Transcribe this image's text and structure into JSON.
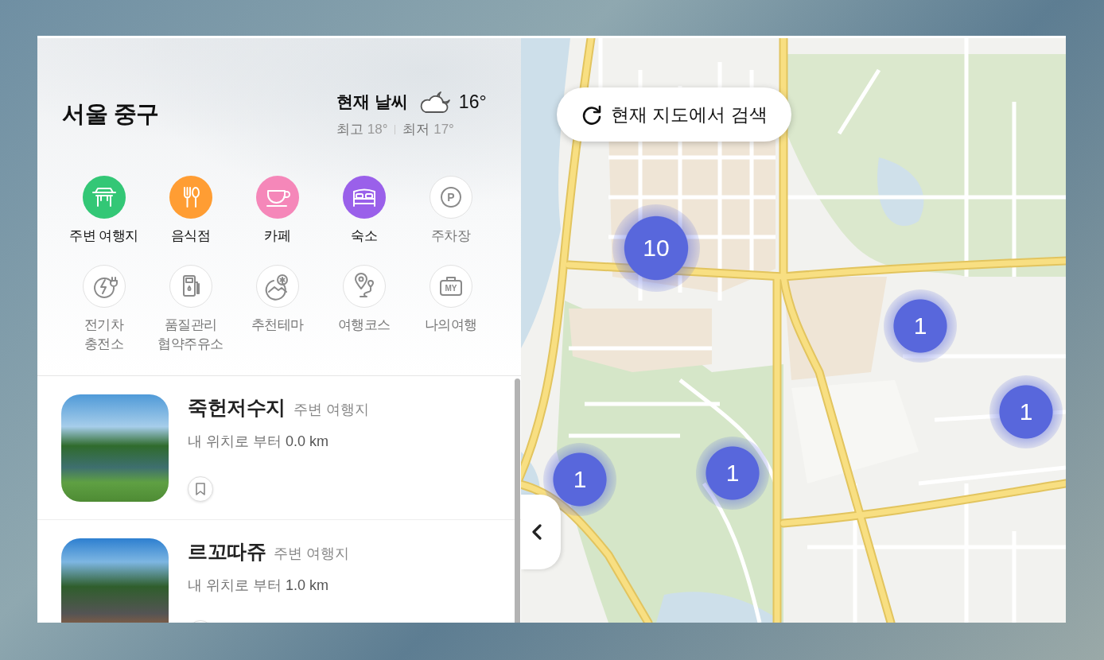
{
  "location": {
    "title": "서울 중구"
  },
  "weather": {
    "label": "현재 날씨",
    "temperature": "16°",
    "high_label": "최고",
    "high": "18°",
    "low_label": "최저",
    "low": "17°"
  },
  "categories": [
    {
      "label": "주변 여행지",
      "color": "#33c776"
    },
    {
      "label": "음식점",
      "color": "#ff9d33"
    },
    {
      "label": "카페",
      "color": "#f587b9"
    },
    {
      "label": "숙소",
      "color": "#9a60ea"
    },
    {
      "label": "주차장",
      "icon_text": "P"
    },
    {
      "label": "전기차 충전소"
    },
    {
      "label": "품질관리 협약주유소"
    },
    {
      "label": "추천테마"
    },
    {
      "label": "여행코스"
    },
    {
      "label": "나의여행",
      "icon_text": "MY"
    }
  ],
  "places": [
    {
      "name": "죽헌저수지",
      "category": "주변 여행지",
      "distance_label": "내 위치로 부터",
      "distance": "0.0 km"
    },
    {
      "name": "르꼬따쥬",
      "category": "주변 여행지",
      "distance_label": "내 위치로 부터",
      "distance": "1.0 km"
    }
  ],
  "map": {
    "search_button": "현재 지도에서 검색",
    "clusters": [
      {
        "count": "10"
      },
      {
        "count": "1"
      },
      {
        "count": "1"
      },
      {
        "count": "1"
      },
      {
        "count": "1"
      }
    ]
  }
}
